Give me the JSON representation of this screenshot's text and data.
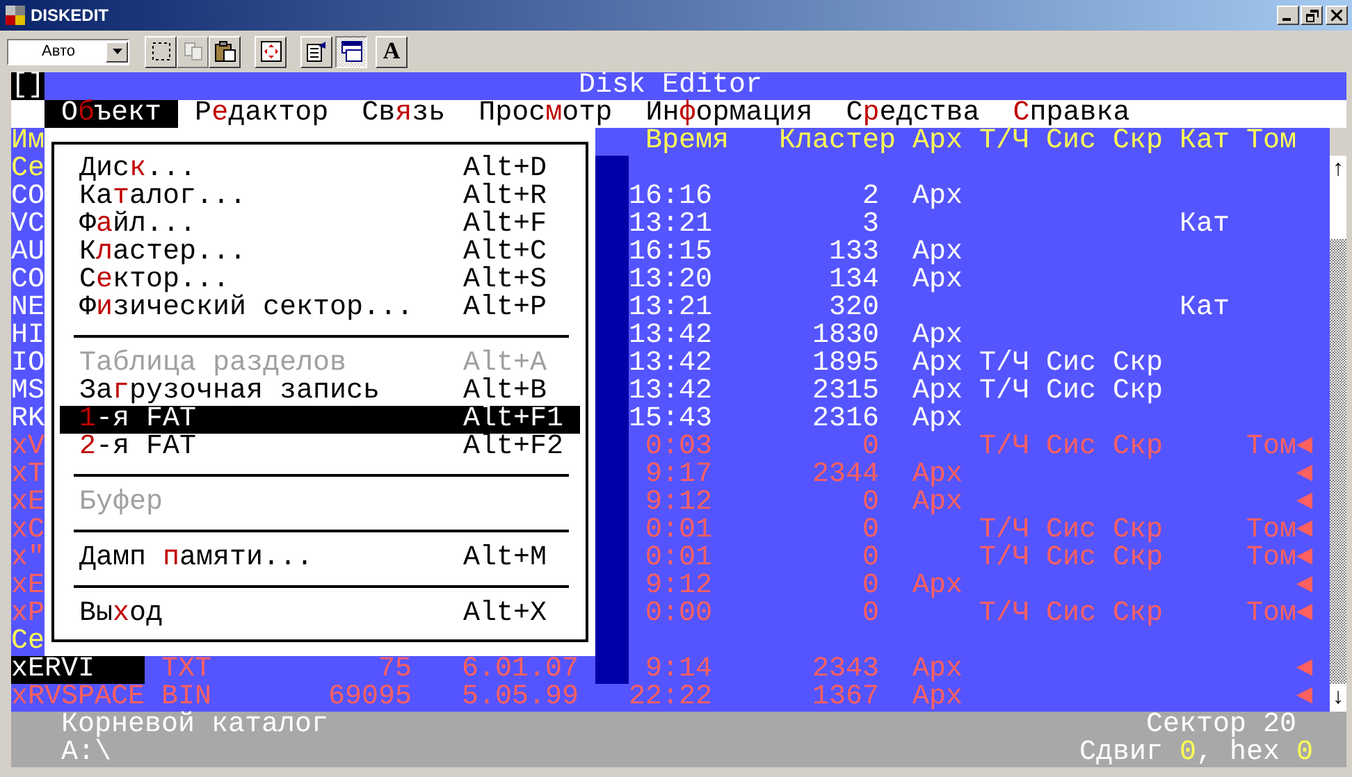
{
  "window": {
    "title": "DISKEDIT"
  },
  "toolbar": {
    "font_size": "Авто",
    "buttons": [
      {
        "kind": "mark",
        "selected": false,
        "disabled": false
      },
      {
        "kind": "copy",
        "selected": false,
        "disabled": true
      },
      {
        "kind": "paste",
        "selected": false,
        "disabled": false
      },
      {
        "kind": "fullscreen",
        "selected": false,
        "disabled": false
      },
      {
        "kind": "properties",
        "selected": false,
        "disabled": false
      },
      {
        "kind": "background",
        "selected": true,
        "disabled": false
      },
      {
        "kind": "font",
        "label": "A",
        "selected": false,
        "disabled": false
      }
    ]
  },
  "console": {
    "close_box": "[]",
    "title": "Disk Editor",
    "menu": [
      {
        "label": "О**б**ъект",
        "selected": true
      },
      {
        "label": "Р**е**дактор",
        "selected": false
      },
      {
        "label": "Св**я**зь",
        "selected": false
      },
      {
        "label": "Прос**м**отр",
        "selected": false
      },
      {
        "label": "Ин**ф**ормация",
        "selected": false
      },
      {
        "label": "С**р**едства",
        "selected": false
      },
      {
        "label": "**С**правка",
        "selected": false
      }
    ],
    "columns": {
      "name": "Им",
      "time": "Время",
      "cluster": "Кластер",
      "archive": "Арх",
      "read_only": "Т/Ч",
      "system": "Сис",
      "hidden": "Скр",
      "directory": "Кат",
      "volume": "Том"
    },
    "rows": [
      {
        "kind": "sector",
        "selected": false,
        "deleted": false,
        "name": "Ce"
      },
      {
        "kind": "file",
        "selected": false,
        "deleted": false,
        "name": "CO",
        "time": "16:16",
        "cluster": "2",
        "archive": "Арх"
      },
      {
        "kind": "file",
        "selected": false,
        "deleted": false,
        "name": "VC",
        "time": "13:21",
        "cluster": "3",
        "directory": "Кат"
      },
      {
        "kind": "file",
        "selected": false,
        "deleted": false,
        "name": "AU",
        "time": "16:15",
        "cluster": "133",
        "archive": "Арх"
      },
      {
        "kind": "file",
        "selected": false,
        "deleted": false,
        "name": "CO",
        "time": "13:20",
        "cluster": "134",
        "archive": "Арх"
      },
      {
        "kind": "file",
        "selected": false,
        "deleted": false,
        "name": "NE",
        "time": "13:21",
        "cluster": "320",
        "directory": "Кат"
      },
      {
        "kind": "file",
        "selected": false,
        "deleted": false,
        "name": "HI",
        "time": "13:42",
        "cluster": "1830",
        "archive": "Арх"
      },
      {
        "kind": "file",
        "selected": false,
        "deleted": false,
        "name": "IO",
        "time": "13:42",
        "cluster": "1895",
        "archive": "Арх",
        "read_only": "Т/Ч",
        "system": "Сис",
        "hidden": "Скр"
      },
      {
        "kind": "file",
        "selected": false,
        "deleted": false,
        "name": "MS",
        "time": "13:42",
        "cluster": "2315",
        "archive": "Арх",
        "read_only": "Т/Ч",
        "system": "Сис",
        "hidden": "Скр"
      },
      {
        "kind": "file",
        "selected": false,
        "deleted": false,
        "name": "RK",
        "time": "15:43",
        "cluster": "2316",
        "archive": "Арх"
      },
      {
        "kind": "file",
        "selected": false,
        "deleted": true,
        "name": "xV",
        "time": "0:03",
        "cluster": "0",
        "read_only": "Т/Ч",
        "system": "Сис",
        "hidden": "Скр",
        "volume": "Том",
        "marker": "◄"
      },
      {
        "kind": "file",
        "selected": false,
        "deleted": true,
        "name": "xT",
        "time": "9:17",
        "cluster": "2344",
        "archive": "Арх",
        "marker": "◄"
      },
      {
        "kind": "file",
        "selected": false,
        "deleted": true,
        "name": "xE",
        "time": "9:12",
        "cluster": "0",
        "archive": "Арх",
        "marker": "◄"
      },
      {
        "kind": "file",
        "selected": false,
        "deleted": true,
        "name": "xC",
        "time": "0:01",
        "cluster": "0",
        "read_only": "Т/Ч",
        "system": "Сис",
        "hidden": "Скр",
        "volume": "Том",
        "marker": "◄"
      },
      {
        "kind": "file",
        "selected": false,
        "deleted": true,
        "name": "x\"",
        "time": "0:01",
        "cluster": "0",
        "read_only": "Т/Ч",
        "system": "Сис",
        "hidden": "Скр",
        "volume": "Том",
        "marker": "◄"
      },
      {
        "kind": "file",
        "selected": false,
        "deleted": true,
        "name": "xE",
        "time": "9:12",
        "cluster": "0",
        "archive": "Арх",
        "marker": "◄"
      },
      {
        "kind": "file",
        "selected": false,
        "deleted": true,
        "name": "xP",
        "time": "0:00",
        "cluster": "0",
        "read_only": "Т/Ч",
        "system": "Сис",
        "hidden": "Скр",
        "volume": "Том",
        "marker": "◄"
      },
      {
        "kind": "sector",
        "selected": false,
        "deleted": false,
        "name": "Ce"
      },
      {
        "kind": "file",
        "selected": true,
        "deleted": true,
        "name": "xERVI",
        "ext": "TXT",
        "size": "75",
        "date": "6.01.07",
        "time": "9:14",
        "cluster": "2343",
        "archive": "Арх",
        "marker": "◄"
      },
      {
        "kind": "file",
        "selected": false,
        "deleted": true,
        "name": "xRVSPACE",
        "ext": "BIN",
        "size": "69095",
        "date": "5.05.99",
        "time": "22:22",
        "cluster": "1367",
        "archive": "Арх",
        "marker": "◄"
      }
    ],
    "scrollbar": {
      "up": "↑",
      "down": "↓"
    },
    "dropdown": [
      {
        "kind": "item",
        "label": "Дис**к**...",
        "shortcut": "Alt+D",
        "disabled": false,
        "selected": false
      },
      {
        "kind": "item",
        "label": "Ка**т**алог...",
        "shortcut": "Alt+R",
        "disabled": false,
        "selected": false
      },
      {
        "kind": "item",
        "label": "Ф**а**йл...",
        "shortcut": "Alt+F",
        "disabled": false,
        "selected": false
      },
      {
        "kind": "item",
        "label": "К**л**астер...",
        "shortcut": "Alt+C",
        "disabled": false,
        "selected": false
      },
      {
        "kind": "item",
        "label": "С**е**ктор...",
        "shortcut": "Alt+S",
        "disabled": false,
        "selected": false
      },
      {
        "kind": "item",
        "label": "Ф**и**зический сектор...",
        "shortcut": "Alt+P",
        "disabled": false,
        "selected": false
      },
      {
        "kind": "separator"
      },
      {
        "kind": "item",
        "label": "Таблица разделов",
        "shortcut": "Alt+A",
        "disabled": true,
        "selected": false
      },
      {
        "kind": "item",
        "label": "За**г**рузочная запись",
        "shortcut": "Alt+B",
        "disabled": false,
        "selected": false
      },
      {
        "kind": "item",
        "label": "**1**-я FAT",
        "shortcut": "Alt+F1",
        "disabled": false,
        "selected": true
      },
      {
        "kind": "item",
        "label": "**2**-я FAT",
        "shortcut": "Alt+F2",
        "disabled": false,
        "selected": false
      },
      {
        "kind": "separator"
      },
      {
        "kind": "item",
        "label": "Буфер",
        "disabled": true,
        "selected": false
      },
      {
        "kind": "separator"
      },
      {
        "kind": "item",
        "label": "Дамп **п**амяти...",
        "shortcut": "Alt+M",
        "disabled": false,
        "selected": false
      },
      {
        "kind": "separator"
      },
      {
        "kind": "item",
        "label": "Вы**х**од",
        "shortcut": "Alt+X",
        "disabled": false,
        "selected": false
      }
    ],
    "status": {
      "location": "Корневой каталог",
      "path": "A:\\",
      "sector": "Сектор 20",
      "offset": "Сдвиг **0**, hex **0**"
    }
  }
}
